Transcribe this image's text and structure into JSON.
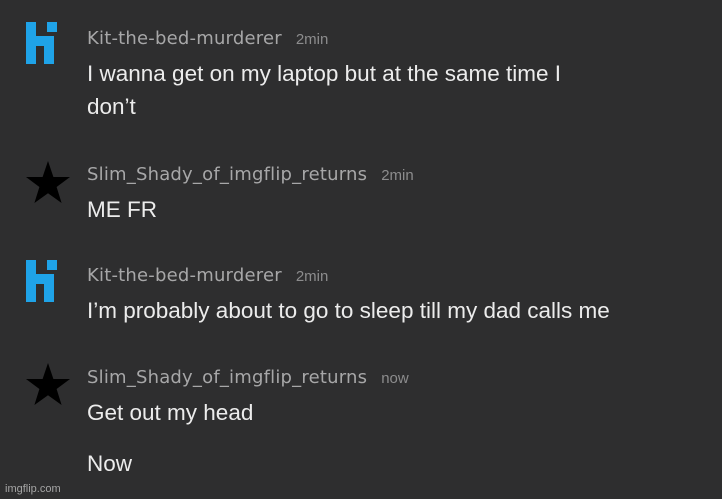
{
  "comments": [
    {
      "username": "Kit-the-bed-murderer",
      "time": "2min",
      "avatar_icon": "blue-k-logo-icon",
      "lines": [
        "I wanna get on my laptop but at the same time I",
        "don’t"
      ]
    },
    {
      "username": "Slim_Shady_of_imgflip_returns",
      "time": "2min",
      "avatar_icon": "black-star-icon",
      "lines": [
        "ME FR"
      ]
    },
    {
      "username": "Kit-the-bed-murderer",
      "time": "2min",
      "avatar_icon": "blue-k-logo-icon",
      "lines": [
        "I’m probably about to go to sleep till my dad calls me"
      ]
    },
    {
      "username": "Slim_Shady_of_imgflip_returns",
      "time": "now",
      "avatar_icon": "black-star-icon",
      "lines": [
        "Get out my head",
        "Now"
      ]
    }
  ],
  "colors": {
    "background": "#2e2e2f",
    "username": "#a7a7a8",
    "timestamp": "#8c8c8d",
    "text": "#ececec",
    "k_logo_blue": "#1fa3e8",
    "star": "#000000"
  },
  "watermark": "imgflip.com"
}
